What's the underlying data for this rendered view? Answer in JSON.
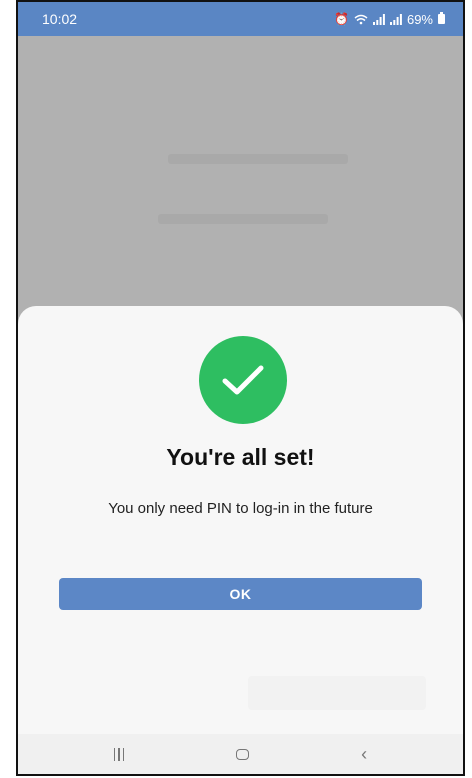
{
  "status_bar": {
    "time": "10:02",
    "battery": "69%",
    "icons": [
      "alarm-icon",
      "wifi-icon",
      "signal-icon",
      "signal-icon",
      "battery-icon"
    ]
  },
  "dialog": {
    "icon": "check-icon",
    "title": "You're all set!",
    "message": "You only need PIN to log-in in the future",
    "ok_label": "OK"
  },
  "nav_bar": {
    "recent_icon": "recent-apps-icon",
    "home_icon": "home-icon",
    "back_icon": "back-icon"
  },
  "colors": {
    "status_bar": "#5a86c4",
    "success": "#2ebe61",
    "button": "#5c87c6",
    "backdrop": "#b1b1b1"
  }
}
